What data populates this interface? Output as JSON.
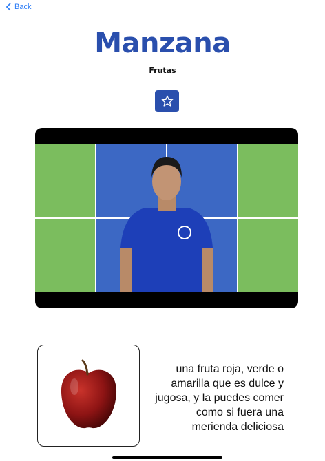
{
  "nav": {
    "back_label": "Back"
  },
  "word": {
    "title": "Manzana",
    "category": "Frutas"
  },
  "definition": "una fruta roja, verde o amarilla que es dulce y jugosa, y la puedes comer como si fuera una merienda deliciosa",
  "icons": {
    "back": "chevron-left-icon",
    "favorite": "star-icon"
  },
  "colors": {
    "accent": "#2a4fad",
    "link": "#2f7ef6"
  }
}
